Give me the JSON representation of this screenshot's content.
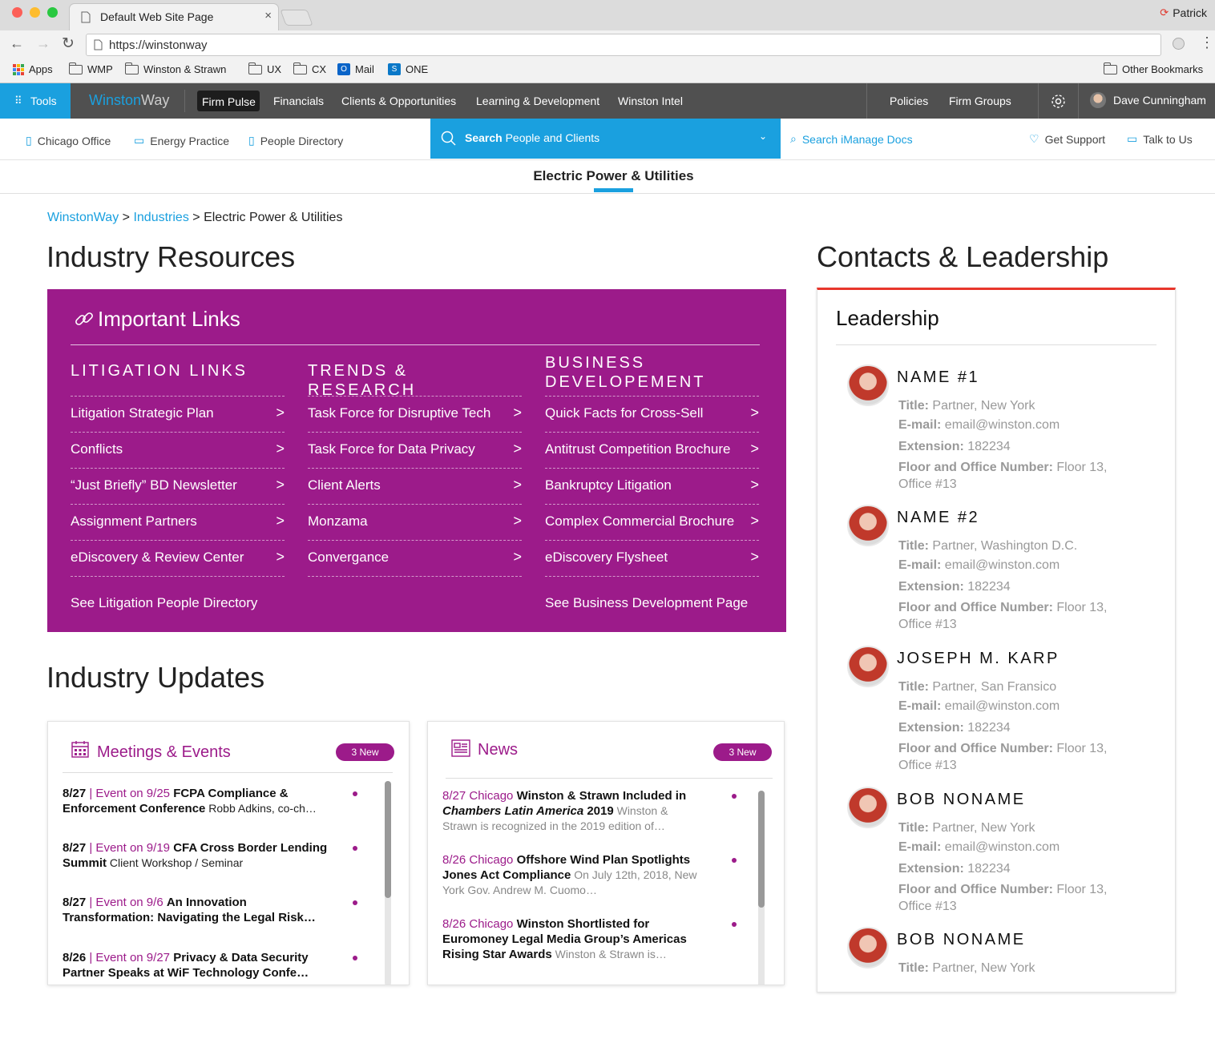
{
  "browser": {
    "tab_title": "Default Web Site Page",
    "profile": "Patrick",
    "url": "https://winstonway",
    "bookmarks": [
      "Apps",
      "WMP",
      "Winston & Strawn",
      "UX",
      "CX",
      "Mail",
      "ONE"
    ],
    "other_bookmarks": "Other Bookmarks"
  },
  "nav": {
    "tools": "Tools",
    "logo_a": "Winston",
    "logo_b": "Way",
    "items": [
      "Firm Pulse",
      "Financials",
      "Clients & Opportunities",
      "Learning & Development",
      "Winston Intel"
    ],
    "right": [
      "Policies",
      "Firm Groups"
    ],
    "user": "Dave Cunningham"
  },
  "subnav": {
    "items": [
      "Chicago Office",
      "Energy Practice",
      "People Directory"
    ],
    "search_bold": "Search",
    "search_rest": " People and Clients",
    "imanage": "Search iManage Docs",
    "support": "Get Support",
    "talk": "Talk to Us"
  },
  "page_tab": "Electric Power & Utilities",
  "breadcrumb": {
    "a": "WinstonWay",
    "b": "Industries",
    "c": "Electric Power & Utilities",
    "sep": ">"
  },
  "resources": {
    "heading": "Industry Resources",
    "links_title": "Important Links",
    "columns": [
      {
        "title": "LITIGATION LINKS",
        "links": [
          "Litigation Strategic Plan",
          "Conflicts",
          "“Just Briefly” BD Newsletter",
          "Assignment Partners",
          "eDiscovery & Review Center"
        ],
        "footer": "See Litigation People Directory"
      },
      {
        "title": "TRENDS & RESEARCH",
        "links": [
          "Task Force for Disruptive Tech",
          "Task Force for Data Privacy",
          "Client Alerts",
          "Monzama",
          "Convergance"
        ],
        "footer": ""
      },
      {
        "title": "BUSINESS DEVELOPEMENT",
        "links": [
          "Quick Facts for Cross-Sell",
          "Antitrust Competition Brochure",
          "Bankruptcy Litigation",
          "Complex Commercial Brochure",
          "eDiscovery Flysheet"
        ],
        "footer": "See Business Development Page"
      }
    ],
    "chevron": ">"
  },
  "updates": {
    "heading": "Industry Updates",
    "meetings": {
      "title": "Meetings & Events",
      "badge": "3 New",
      "items": [
        {
          "date": "8/27",
          "meta": " | Event on 9/25 ",
          "bold": "FCPA Compliance & Enforcement Conference",
          "rest": " Robb Adkins, co-ch…"
        },
        {
          "date": "8/27",
          "meta": " | Event on 9/19 ",
          "bold": "CFA Cross Border Lending Summit",
          "rest": " Client Workshop / Seminar"
        },
        {
          "date": "8/27",
          "meta": " | Event on 9/6 ",
          "bold": "An Innovation Transformation: Navigating the Legal Risk…",
          "rest": ""
        },
        {
          "date": "8/26",
          "meta": " | Event on 9/27 ",
          "bold": "Privacy & Data Security Partner Speaks at WiF Technology Confe…",
          "rest": ""
        }
      ]
    },
    "news": {
      "title": "News",
      "badge": "3 New",
      "items": [
        {
          "meta": "8/27 Chicago ",
          "bold": "Winston & Strawn Included in ",
          "italic": "Chambers Latin America",
          "bold2": " 2019",
          "rest": " Winston & Strawn is recognized in the 2019 edition of…"
        },
        {
          "meta": "8/26 Chicago ",
          "bold": "Offshore Wind Plan Spotlights Jones Act Compliance",
          "italic": "",
          "bold2": "",
          "rest": " On July 12th, 2018, New York Gov. Andrew M. Cuomo…"
        },
        {
          "meta": "8/26 Chicago ",
          "bold": "Winston Shortlisted for Euromoney Legal Media Group’s Americas Rising Star Awards",
          "italic": "",
          "bold2": "",
          "rest": " Winston & Strawn is…"
        }
      ]
    }
  },
  "contacts": {
    "heading": "Contacts & Leadership",
    "sub": "Leadership",
    "labels": {
      "title": "Title:",
      "email": "E-mail:",
      "ext": "Extension:",
      "floor": "Floor and Office Number:"
    },
    "people": [
      {
        "name": "NAME #1",
        "title": "Partner, New York",
        "email": "email@winston.com",
        "ext": "182234",
        "floor": "Floor 13,",
        "office": "Office #13"
      },
      {
        "name": "NAME #2",
        "title": "Partner, Washington D.C.",
        "email": "email@winston.com",
        "ext": "182234",
        "floor": "Floor 13,",
        "office": "Office #13"
      },
      {
        "name": "JOSEPH M. KARP",
        "title": "Partner, San Fransico",
        "email": "email@winston.com",
        "ext": "182234",
        "floor": "Floor 13,",
        "office": "Office #13"
      },
      {
        "name": "BOB NONAME",
        "title": "Partner, New York",
        "email": "email@winston.com",
        "ext": "182234",
        "floor": "Floor 13,",
        "office": "Office #13"
      },
      {
        "name": "BOB NONAME",
        "title": "Partner, New York"
      }
    ]
  },
  "colors": {
    "accent_blue": "#1aa0df",
    "magenta": "#9c1b8a",
    "nav_gray": "#505050",
    "contacts_red": "#e8362b"
  }
}
